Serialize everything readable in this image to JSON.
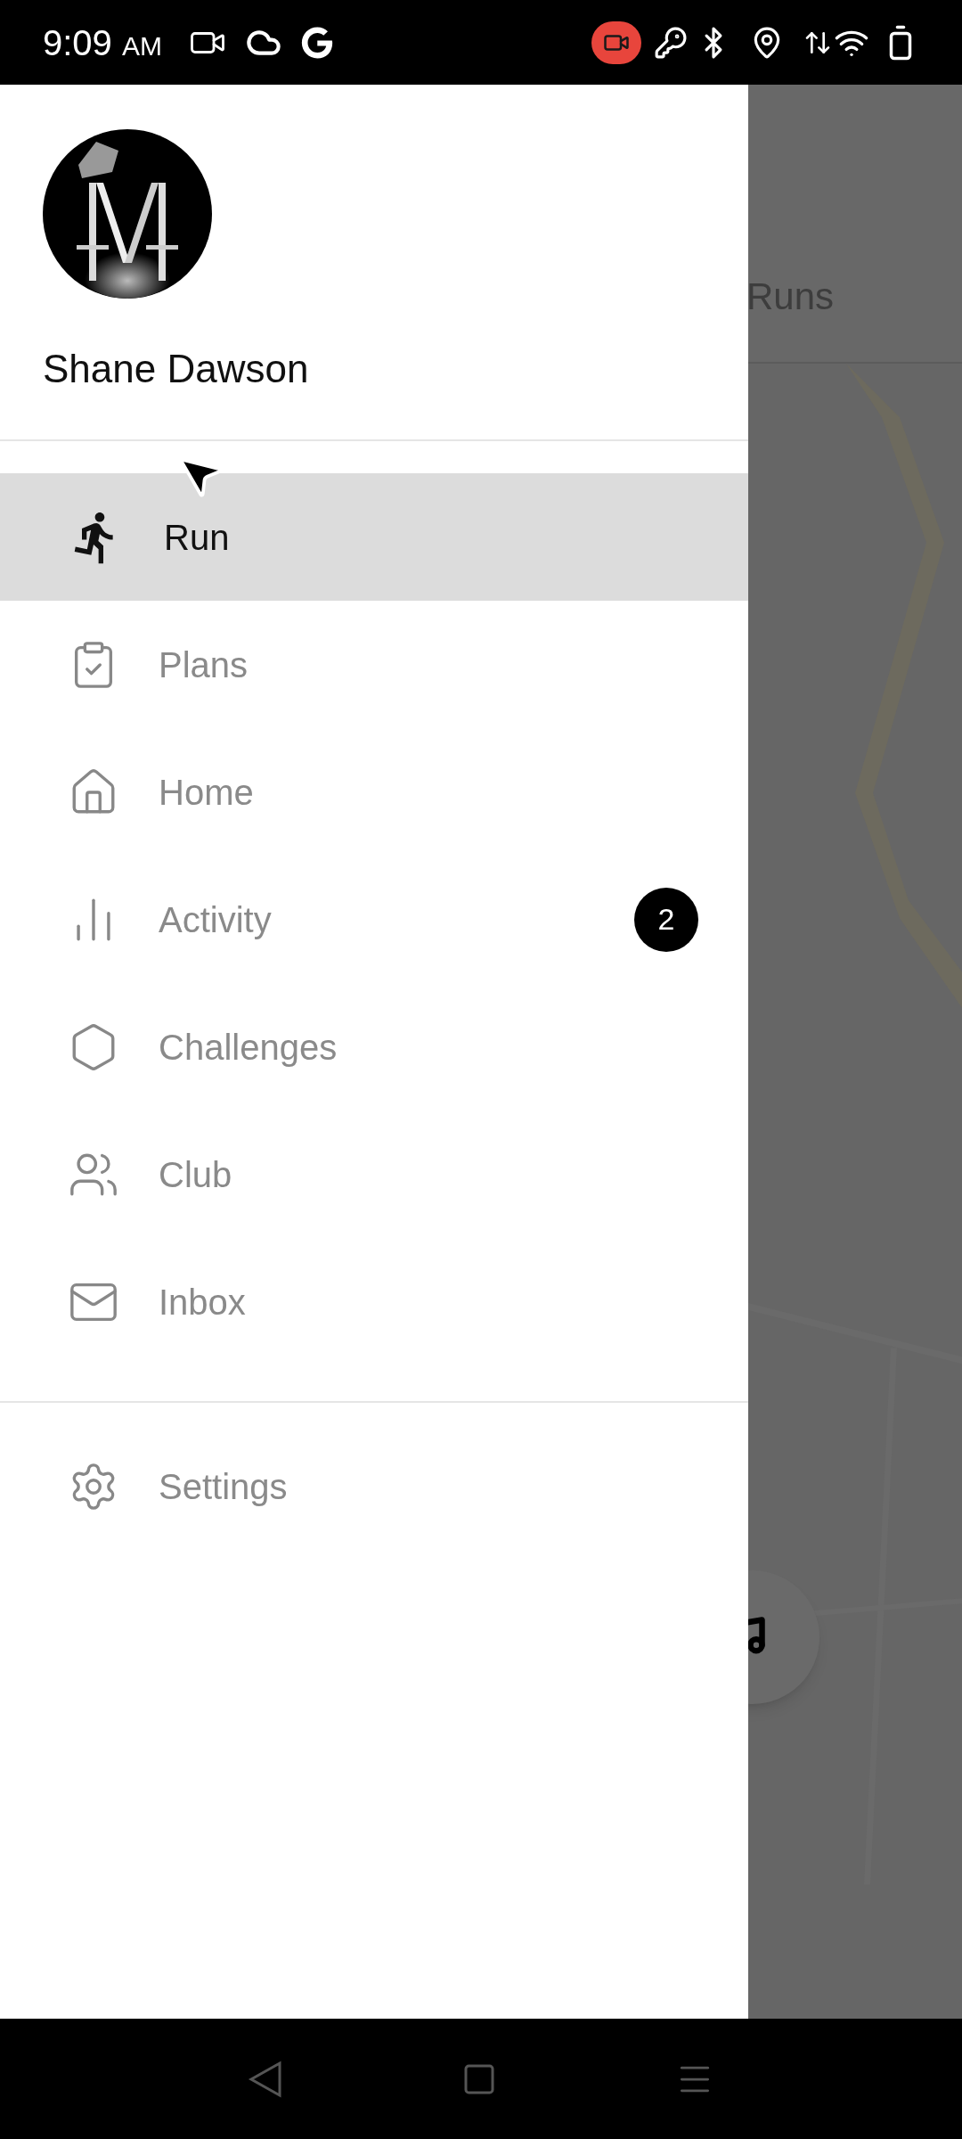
{
  "status_bar": {
    "time": "9:09",
    "meridiem": "AM"
  },
  "drawer": {
    "profile": {
      "name": "Shane Dawson"
    },
    "menu": [
      {
        "label": "Run",
        "selected": true
      },
      {
        "label": "Plans",
        "selected": false
      },
      {
        "label": "Home",
        "selected": false
      },
      {
        "label": "Activity",
        "selected": false,
        "badge": "2"
      },
      {
        "label": "Challenges",
        "selected": false
      },
      {
        "label": "Club",
        "selected": false
      },
      {
        "label": "Inbox",
        "selected": false
      }
    ],
    "footer": [
      {
        "label": "Settings",
        "selected": false
      }
    ]
  },
  "background": {
    "title": "Runs"
  }
}
